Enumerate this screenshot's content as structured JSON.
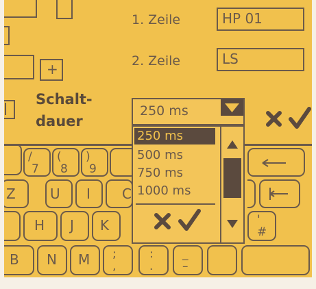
{
  "fields": [
    {
      "label": "1. Zeile",
      "value": "HP 01"
    },
    {
      "label": "2. Zeile",
      "value": "LS"
    }
  ],
  "plus_label": "+",
  "schaltdauer": {
    "label_line1": "Schalt-",
    "label_line2": "dauer",
    "selected": "250 ms",
    "options": [
      "250 ms",
      "500 ms",
      "750 ms",
      "1000 ms"
    ],
    "selected_index": 0
  },
  "icons": {
    "cancel": "cancel-x-icon",
    "confirm": "check-icon",
    "dropdown_arrow": "triangle-down-icon",
    "scroll_up": "triangle-up-icon",
    "scroll_down": "triangle-down-icon",
    "backspace": "arrow-left-icon",
    "tab": "tab-left-icon"
  },
  "keyboard": {
    "row1": [
      {
        "top": "/",
        "bottom": "7"
      },
      {
        "top": "(",
        "bottom": "8"
      },
      {
        "top": ")",
        "bottom": "9"
      }
    ],
    "row2": [
      "Z",
      "U",
      "I",
      "C"
    ],
    "row3": [
      "H",
      "J",
      "K"
    ],
    "row4": [
      "B",
      "N",
      "M"
    ],
    "row4_punct": [
      {
        "top": ";",
        "bottom": ","
      },
      {
        "top": ":",
        "bottom": "."
      },
      {
        "top": "_",
        "bottom": "–"
      }
    ],
    "row3_right": {
      "top": "'",
      "bottom": "#"
    }
  },
  "colors": {
    "screen": "#f1c14d",
    "ink": "#5b4a3e"
  }
}
